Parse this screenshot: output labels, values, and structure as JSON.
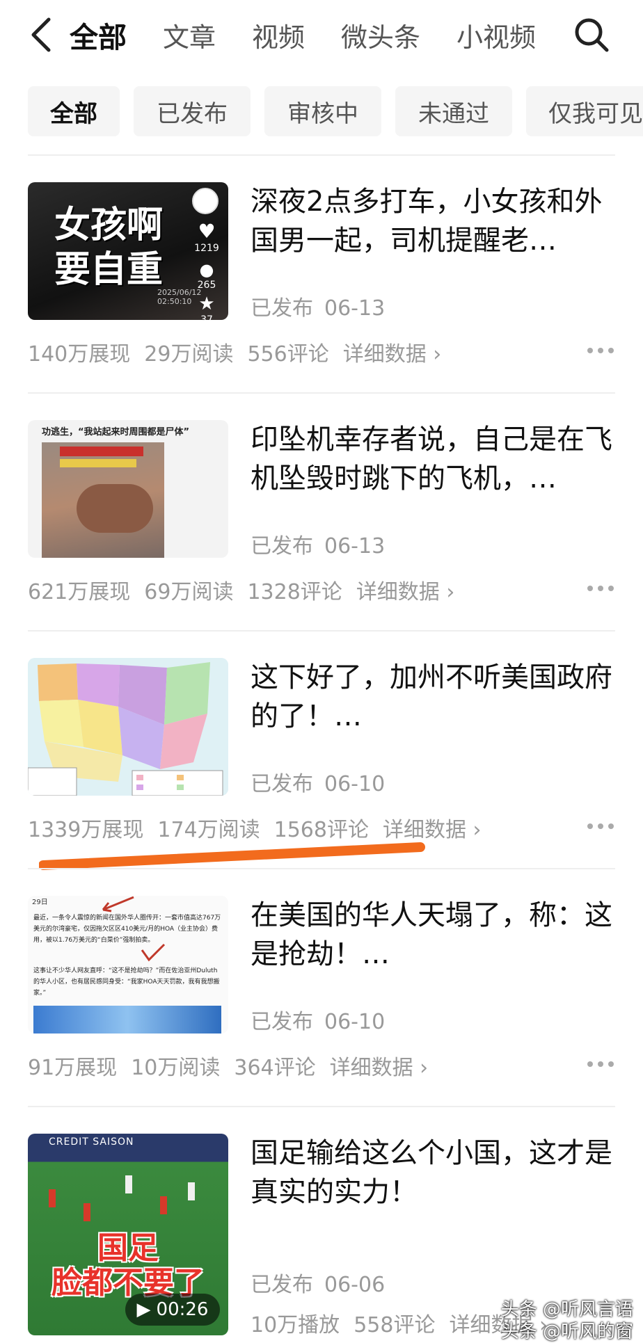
{
  "nav": {
    "tabs": [
      "全部",
      "文章",
      "视频",
      "微头条",
      "小视频"
    ],
    "active_tab": 0
  },
  "filters": [
    "全部",
    "已发布",
    "审核中",
    "未通过",
    "仅我可见"
  ],
  "items": [
    {
      "title": "深夜2点多打车，小女孩和外国男一起，司机提醒老…",
      "thumb_text": [
        "女孩啊",
        "要自重"
      ],
      "thumb_counts": [
        "1219",
        "265",
        "37"
      ],
      "thumb_time": "2025/06/12 02:50:10",
      "status": "已发布",
      "date": "06-13",
      "stats": [
        "140万展现",
        "29万阅读",
        "556评论"
      ],
      "detail": "详细数据 ›"
    },
    {
      "title": "印坠机幸存者说，自己是在飞机坠毁时跳下的飞机，…",
      "thumb_text": [
        "功逃生，“我站起来时周围都是尸体”"
      ],
      "status": "已发布",
      "date": "06-13",
      "stats": [
        "621万展现",
        "69万阅读",
        "1328评论"
      ],
      "detail": "详细数据 ›"
    },
    {
      "title": "这下好了，加州不听美国政府的了！…",
      "status": "已发布",
      "date": "06-10",
      "stats": [
        "1339万展现",
        "174万阅读",
        "1568评论"
      ],
      "detail": "详细数据 ›"
    },
    {
      "title": "在美国的华人天塌了，称：这是抢劫！…",
      "thumb_text": [
        "29日",
        "最近，一条令人震惊的新闻在国外华人圈传开：一套市值高达767万美元的尔湾豪宅，仅因拖欠区区410美元/月的HOA（业主协会）费用，被以1.76万美元的“白菜价”强制拍卖。",
        "这事让不少华人网友直呼：“这不是抢劫吗？”而在佐治亚州Duluth的华人小区，也有居民感同身受：“我家HOA天天罚款，我有我想搬家。”"
      ],
      "status": "已发布",
      "date": "06-10",
      "stats": [
        "91万展现",
        "10万阅读",
        "364评论"
      ],
      "detail": "详细数据 ›"
    },
    {
      "title": "国足输给这么个小国，这才是真实的实力！",
      "thumb_text": [
        "国足",
        "脸都不要了",
        "CREDIT SAISON"
      ],
      "video_duration": "00:26",
      "status": "已发布",
      "date": "06-06",
      "stats": [
        "10万播放",
        "558评论"
      ],
      "detail": "详细数据 ›"
    }
  ],
  "watermark": [
    "头条 @听风言语",
    "头条 @听风的窗"
  ],
  "colors": {
    "highlight": "#f26b1d",
    "muted": "#999999"
  }
}
